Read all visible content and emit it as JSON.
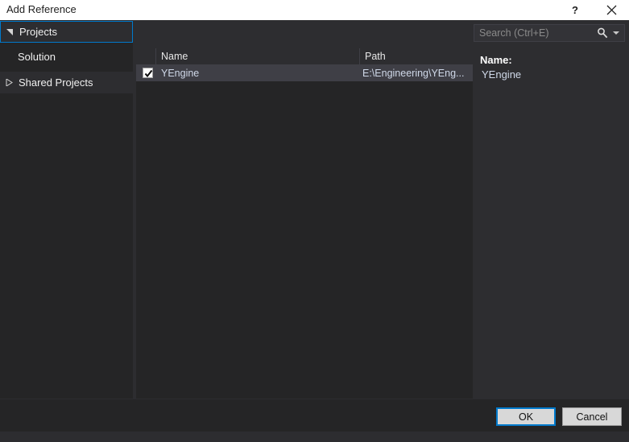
{
  "window": {
    "title": "Add Reference",
    "help_icon": "question-mark-icon",
    "close_icon": "close-icon"
  },
  "sidebar": {
    "items": [
      {
        "label": "Projects",
        "expander": "expanded-triangle-icon",
        "selected": true
      },
      {
        "label": "Solution",
        "expander": "none",
        "selected": false
      },
      {
        "label": "Shared Projects",
        "expander": "collapsed-triangle-icon",
        "selected": false
      }
    ]
  },
  "search": {
    "placeholder": "Search (Ctrl+E)",
    "value": "",
    "icon": "search-icon",
    "dropdown_icon": "chevron-down-icon"
  },
  "list": {
    "columns": [
      "",
      "Name",
      "Path"
    ],
    "rows": [
      {
        "checked": true,
        "name": "YEngine",
        "path": "E:\\Engineering\\YEng..."
      }
    ]
  },
  "detail": {
    "name_label": "Name:",
    "name_value": "YEngine"
  },
  "footer": {
    "ok_label": "OK",
    "cancel_label": "Cancel"
  },
  "colors": {
    "accent": "#007acc",
    "titlebar_bg": "#ffffff",
    "dialog_bg": "#2d2d30",
    "panel_bg": "#252526",
    "row_selected_bg": "#3f3f46",
    "text": "#f0f0f0",
    "text_muted": "#8a8a8a",
    "link_text": "#cfd8e8"
  }
}
